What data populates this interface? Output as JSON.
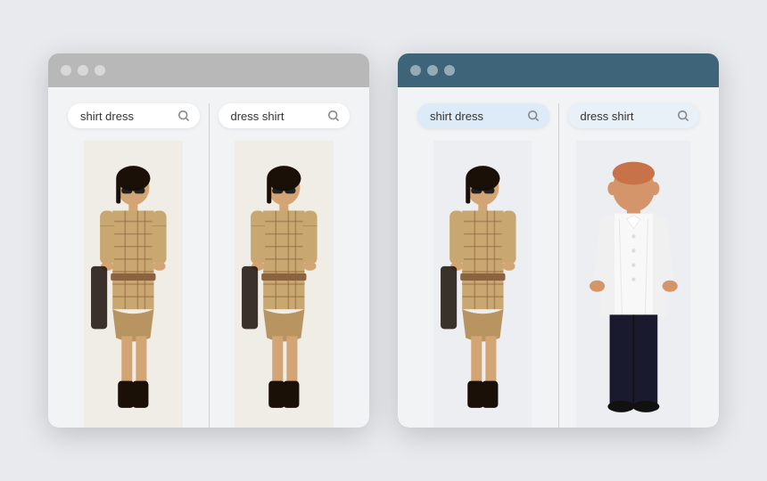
{
  "windows": [
    {
      "id": "gray-window",
      "theme": "gray",
      "panels": [
        {
          "id": "panel-shirt-dress-gray",
          "search_text": "shirt dress",
          "image_type": "woman",
          "search_icon": "🔍"
        },
        {
          "id": "panel-dress-shirt-gray",
          "search_text": "dress shirt",
          "image_type": "woman",
          "search_icon": "🔍"
        }
      ]
    },
    {
      "id": "teal-window",
      "theme": "teal",
      "panels": [
        {
          "id": "panel-shirt-dress-teal",
          "search_text": "shirt dress",
          "image_type": "woman",
          "search_icon": "🔍"
        },
        {
          "id": "panel-dress-shirt-teal",
          "search_text": "dress shirt",
          "image_type": "man",
          "search_icon": "🔍"
        }
      ]
    }
  ],
  "dots": [
    "dot1",
    "dot2",
    "dot3"
  ]
}
